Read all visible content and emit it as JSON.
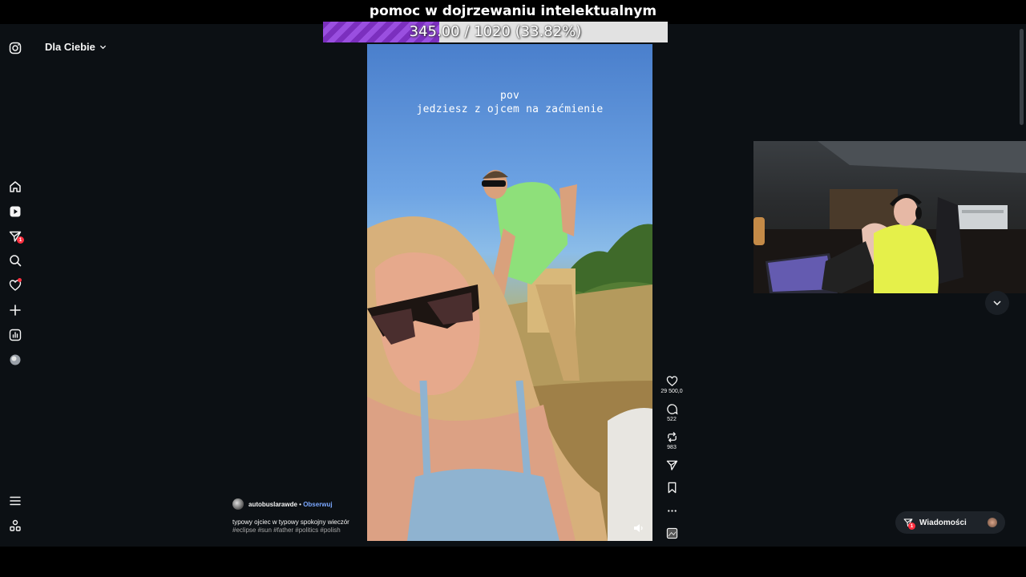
{
  "stream_overlay": {
    "goal_title": "pomoc w dojrzewaniu intelektualnym",
    "goal_text": "345.00 / 1020 (33.82%)",
    "goal_progress": 0.3382
  },
  "nav": {
    "items": [
      {
        "name": "instagram-logo-icon"
      },
      {
        "name": "home-icon"
      },
      {
        "name": "reels-icon"
      },
      {
        "name": "direct-messages-icon",
        "badge": "1"
      },
      {
        "name": "search-icon"
      },
      {
        "name": "notifications-heart-icon"
      },
      {
        "name": "create-plus-icon"
      },
      {
        "name": "dashboard-icon"
      },
      {
        "name": "profile-avatar-icon"
      },
      {
        "name": "menu-icon"
      },
      {
        "name": "also-from-meta-icon"
      }
    ]
  },
  "feed": {
    "title": "Dla Ciebie"
  },
  "reel": {
    "caption_line1": "pov",
    "caption_line2": "jedziesz z ojcem na zaćmienie"
  },
  "actions": {
    "likes": "29 500,0",
    "comments": "522",
    "reposts": "983"
  },
  "post": {
    "author": "autobuslarawde",
    "separator": "•",
    "follow_label": "Obserwuj",
    "description": "typowy ojciec w typowy spokojny wieczór",
    "tags": "#eclipse #sun #father #politics #polish"
  },
  "messages": {
    "label": "Wiadomości",
    "badge": "1"
  },
  "colors": {
    "background": "#0c1014",
    "accent_link": "#7aa7ff",
    "badge": "#ff3040",
    "goal_fill": "#7b2fbe"
  }
}
